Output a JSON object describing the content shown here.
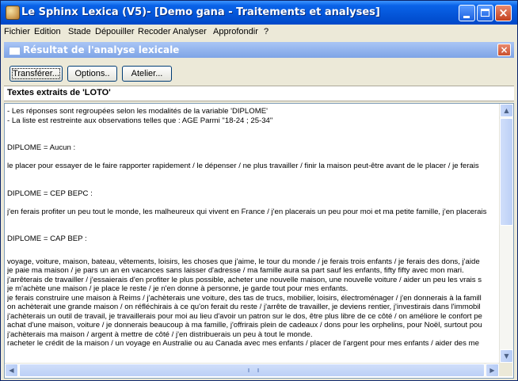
{
  "window": {
    "title": "Le Sphinx Lexica (V5)- [Demo gana - Traitements et analyses]"
  },
  "menu": [
    "Fichier",
    "Edition",
    "Stade",
    "Dépouiller",
    "Recoder",
    "Analyser",
    "Approfondir",
    "?"
  ],
  "child_window": {
    "title": "Résultat de l'analyse lexicale",
    "close_glyph": "×"
  },
  "toolbar": {
    "transfer_label": "Transférer...",
    "options_label": "Options..",
    "atelier_label": "Atelier..."
  },
  "header": {
    "text": "Textes extraits de 'LOTO'"
  },
  "results": {
    "intro": [
      "- Les réponses sont regroupées selon les modalités de la variable 'DIPLOME'",
      "- La liste est restreinte aux observations telles que : AGE Parmi \"18-24 ; 25-34\""
    ],
    "groups": [
      {
        "heading": "DIPLOME = Aucun :",
        "lines": [
          "le placer pour essayer de le faire rapporter rapidement / le dépenser / ne plus travailler / finir la maison peut-être avant de le placer / je ferais"
        ]
      },
      {
        "heading": "DIPLOME = CEP BEPC :",
        "lines": [
          "j'en ferais profiter un peu tout le monde, les malheureux qui vivent en France / j'en placerais un peu pour moi et ma petite famille, j'en placerais"
        ]
      },
      {
        "heading": "DIPLOME = CAP BEP :",
        "lines": [
          "voyage, voiture, maison, bateau, vêtements, loisirs, les choses que j'aime, le tour du monde / je ferais trois enfants / je ferais des dons, j'aide",
          "je paie ma maison / je pars un an en vacances sans laisser d'adresse / ma famille aura sa part sauf les enfants, fifty fifty avec mon mari.",
          "j'arrêterais de travailler / j'essaierais d'en profiter le plus possible, acheter une nouvelle maison, une nouvelle voiture / aider un peu les vrais s",
          "je m'achète une maison / je place le reste / je n'en donne à personne, je garde tout pour mes enfants.",
          "je ferais construire une maison à Reims / j'achèterais une voiture, des tas de trucs, mobilier, loisirs, électroménager / j'en donnerais à la famill",
          "on achèterait une grande maison / on réfléchirais à ce qu'on ferait du reste / j'arrête de travailler, je deviens rentier, j'investirais dans l'immobil",
          "j'achèterais un outil de travail, je travaillerais pour moi au lieu d'avoir un patron sur le dos, être plus libre de ce côté / on améliore le confort pe",
          "achat d'une maison, voiture / je donnerais beaucoup à ma famille, j'offrirais plein de cadeaux / dons pour les orphelins, pour Noël, surtout pou",
          "j'achèterais ma maison / argent à mettre de côté / j'en distribuerais un peu à tout le monde.",
          "racheter le crédit de la maison / un voyage en Australie ou au Canada avec mes enfants / placer de l'argent pour mes enfants / aider des me"
        ]
      }
    ]
  },
  "scrollbars": {
    "up_arrow": "▲",
    "down_arrow": "▼",
    "left_arrow": "◀",
    "right_arrow": "▶"
  }
}
